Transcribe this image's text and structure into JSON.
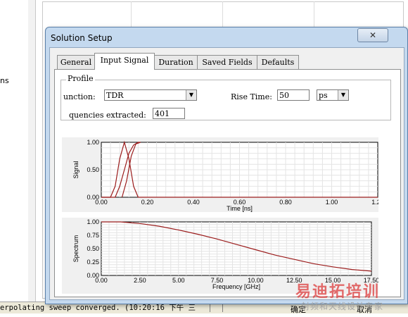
{
  "background": {
    "left_text": "ns",
    "status": "erpolating sweep converged. (10:20:16 下午 三",
    "status_sep1": "|",
    "status_sep2": "|"
  },
  "dialog": {
    "title": "Solution Setup",
    "close": "✕",
    "tabs": [
      "General",
      "Input Signal",
      "Duration",
      "Saved Fields",
      "Defaults"
    ],
    "active_tab": 1,
    "profile": {
      "legend": "Profile",
      "function_label": "unction:",
      "function_value": "TDR",
      "rise_time_label": "Rise Time:",
      "rise_time_value": "50",
      "rise_time_unit": "ps",
      "freq_label": "quencies extracted:",
      "freq_value": "401"
    },
    "ok_label": "确定",
    "cancel_label": "取消"
  },
  "chart_data": [
    {
      "type": "line",
      "xlabel": "Time [ns]",
      "ylabel": "Signal",
      "xlim": [
        0.0,
        1.2
      ],
      "ylim": [
        0.0,
        1.0
      ],
      "x_ticks": [
        "0.00",
        "0.20",
        "0.40",
        "0.60",
        "0.80",
        "1.00",
        "1.20"
      ],
      "y_ticks": [
        "0.00",
        "0.50",
        "1.00"
      ],
      "grid": true,
      "series": [
        {
          "x": [
            0.0,
            0.04,
            0.06,
            0.08,
            0.1,
            0.12,
            0.14,
            0.16,
            1.2
          ],
          "y": [
            0.0,
            0.0,
            0.2,
            0.7,
            1.0,
            0.7,
            0.2,
            0.0,
            0.0
          ]
        },
        {
          "x": [
            0.0,
            0.06,
            0.08,
            0.1,
            0.12,
            0.14,
            0.16,
            0.17
          ],
          "y": [
            0.0,
            0.0,
            0.2,
            0.5,
            0.8,
            0.95,
            1.0,
            1.0
          ]
        },
        {
          "x": [
            0.09,
            0.11,
            0.13,
            0.15,
            0.17
          ],
          "y": [
            0.0,
            0.3,
            0.75,
            0.97,
            1.0
          ]
        }
      ]
    },
    {
      "type": "line",
      "xlabel": "Frequency [GHz]",
      "ylabel": "Spectrum",
      "xlim": [
        0.0,
        17.5
      ],
      "ylim": [
        0.0,
        1.0
      ],
      "x_ticks": [
        "0.00",
        "2.50",
        "5.00",
        "7.50",
        "10.00",
        "12.50",
        "15.00",
        "17.50"
      ],
      "y_ticks": [
        "0.00",
        "0.25",
        "0.50",
        "0.75",
        "1.00"
      ],
      "grid": true,
      "series": [
        {
          "x": [
            0.0,
            1.25,
            2.5,
            3.75,
            5.0,
            6.25,
            7.5,
            8.75,
            10.0,
            11.25,
            12.5,
            13.75,
            15.0,
            16.25,
            17.5
          ],
          "y": [
            1.0,
            1.0,
            0.97,
            0.92,
            0.85,
            0.77,
            0.68,
            0.58,
            0.48,
            0.38,
            0.3,
            0.22,
            0.16,
            0.11,
            0.08
          ]
        }
      ]
    }
  ]
}
